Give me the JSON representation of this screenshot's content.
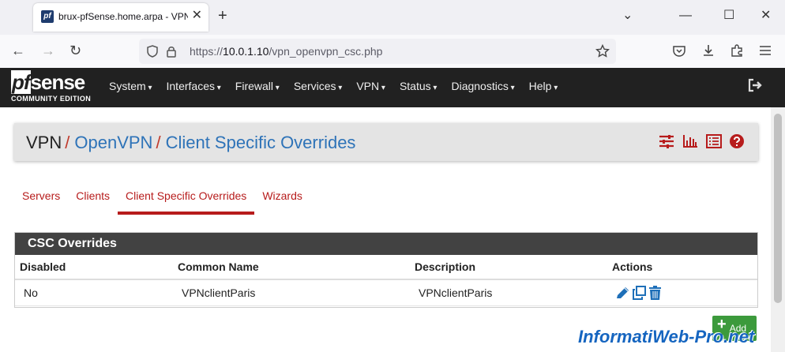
{
  "browser": {
    "tab_title": "brux-pfSense.home.arpa - VPN",
    "tab_close": "✕",
    "new_tab": "+",
    "window_controls": {
      "minimize": "⌄",
      "min": "—",
      "max": "☐",
      "close": "✕"
    },
    "url_prefix": "https://",
    "url_host": "10.0.1.10",
    "url_path": "/vpn_openvpn_csc.php",
    "nav": {
      "back": "←",
      "forward": "→",
      "reload": "↻"
    },
    "icons": {
      "shield": "shield-icon",
      "lock": "lock-icon",
      "star": "star-icon",
      "pocket": "pocket-icon",
      "download": "download-icon",
      "extensions": "extensions-icon",
      "menu": "hamburger-menu-icon"
    }
  },
  "header": {
    "logo_pf": "pf",
    "logo_sense": "sense",
    "logo_sub": "COMMUNITY EDITION",
    "menu": [
      "System",
      "Interfaces",
      "Firewall",
      "Services",
      "VPN",
      "Status",
      "Diagnostics",
      "Help"
    ],
    "logout_icon": "logout-icon"
  },
  "breadcrumb": {
    "root": "VPN",
    "sep1": "/",
    "level1": "OpenVPN",
    "sep2": "/",
    "level2": "Client Specific Overrides"
  },
  "subtabs": [
    {
      "label": "Servers",
      "active": false
    },
    {
      "label": "Clients",
      "active": false
    },
    {
      "label": "Client Specific Overrides",
      "active": true
    },
    {
      "label": "Wizards",
      "active": false
    }
  ],
  "panel": {
    "title": "CSC Overrides",
    "columns": [
      "Disabled",
      "Common Name",
      "Description",
      "Actions"
    ],
    "rows": [
      {
        "disabled": "No",
        "common_name": "VPNclientParis",
        "description": "VPNclientParis"
      }
    ]
  },
  "add_button": "Add",
  "watermark": "InformatiWeb-Pro.net",
  "colors": {
    "accent_red": "#b71c1c",
    "link_blue": "#2e73b8",
    "header_bg": "#212121",
    "add_green": "#3c9a3c"
  }
}
